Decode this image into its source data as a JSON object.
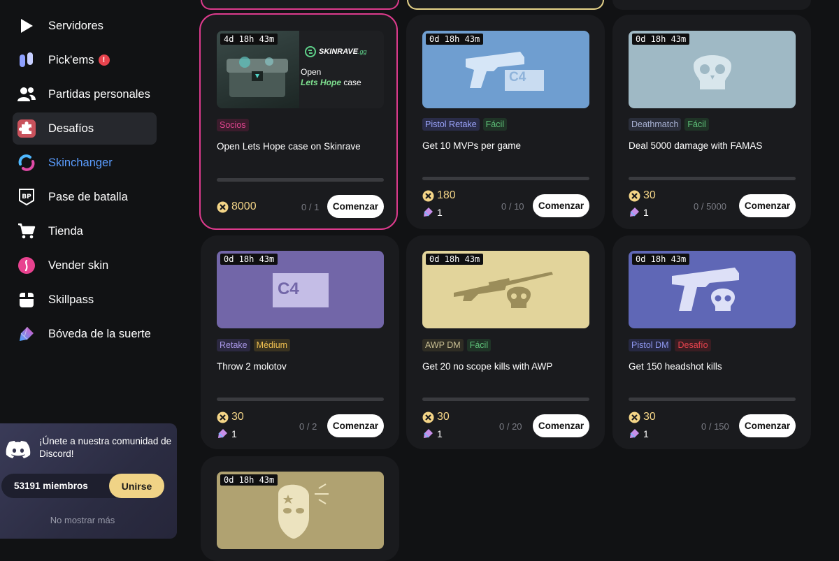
{
  "nav": {
    "items": [
      {
        "label": "Servidores",
        "icon": "play-icon"
      },
      {
        "label": "Pick'ems",
        "icon": "pickems-icon"
      },
      {
        "label": "Partidas personales",
        "icon": "users-icon"
      },
      {
        "label": "Desafíos",
        "icon": "puzzle-icon"
      },
      {
        "label": "Skinchanger",
        "icon": "skinchanger-icon"
      },
      {
        "label": "Pase de batalla",
        "icon": "battlepass-icon"
      },
      {
        "label": "Tienda",
        "icon": "cart-icon"
      },
      {
        "label": "Vender skin",
        "icon": "sell-skin-icon"
      },
      {
        "label": "Skillpass",
        "icon": "skillpass-icon"
      },
      {
        "label": "Bóveda de la suerte",
        "icon": "luck-vault-icon"
      }
    ],
    "alert_glyph": "!"
  },
  "discord": {
    "message": "¡Únete a nuestra comunidad de Discord!",
    "members": "53191 miembros",
    "join_label": "Unirse",
    "dismiss_label": "No mostrar más"
  },
  "colors": {
    "accent_pink": "#dd3b8d",
    "coin": "#f4d587",
    "button_yellow": "#f0d386"
  },
  "cards": [
    {
      "timer": "4d 18h 43m",
      "tags": [
        {
          "text": "Socios",
          "color": "#e0458f",
          "bg": "#3b1c2c"
        }
      ],
      "title": "Open Lets Hope case on Skinrave",
      "coins": "8000",
      "progress": "0 / 1",
      "button": "Comenzar",
      "sponsor": {
        "brand": "SKINRAVE",
        "brand_suffix": ".gg",
        "line1": "Open",
        "highlight": "Lets Hope",
        "line2_suffix": " case"
      }
    },
    {
      "timer": "0d 18h 43m",
      "tags": [
        {
          "text": "Pistol Retake",
          "color": "#9da6ff",
          "bg": "#2a2c48"
        },
        {
          "text": "Fácil",
          "color": "#5fc37a",
          "bg": "#1f3326"
        }
      ],
      "title": "Get 10 MVPs per game",
      "coins": "180",
      "gems": "1",
      "progress": "0 / 10",
      "button": "Comenzar",
      "c4": "C4"
    },
    {
      "timer": "0d 18h 43m",
      "tags": [
        {
          "text": "Deathmatch",
          "color": "#aab4d6",
          "bg": "#2a2e3a"
        },
        {
          "text": "Fácil",
          "color": "#5fc37a",
          "bg": "#1f3326"
        }
      ],
      "title": "Deal 5000 damage with FAMAS",
      "coins": "30",
      "gems": "1",
      "progress": "0 / 5000",
      "button": "Comenzar"
    },
    {
      "timer": "0d 18h 43m",
      "tags": [
        {
          "text": "Retake",
          "color": "#a896e6",
          "bg": "#2b2840"
        },
        {
          "text": "Médium",
          "color": "#f0c050",
          "bg": "#3a3320"
        }
      ],
      "title": "Throw 2 molotov",
      "coins": "30",
      "gems": "1",
      "progress": "0 / 2",
      "button": "Comenzar",
      "c4": "C4"
    },
    {
      "timer": "0d 18h 43m",
      "tags": [
        {
          "text": "AWP DM",
          "color": "#c9bf93",
          "bg": "#2f2d24"
        },
        {
          "text": "Fácil",
          "color": "#5fc37a",
          "bg": "#1f3326"
        }
      ],
      "title": "Get 20 no scope kills with AWP",
      "coins": "30",
      "gems": "1",
      "progress": "0 / 20",
      "button": "Comenzar"
    },
    {
      "timer": "0d 18h 43m",
      "tags": [
        {
          "text": "Pistol DM",
          "color": "#8f98f0",
          "bg": "#262842"
        },
        {
          "text": "Desafío",
          "color": "#e8434d",
          "bg": "#3a1d22"
        }
      ],
      "title": "Get 150 headshot kills",
      "coins": "30",
      "gems": "1",
      "progress": "0 / 150",
      "button": "Comenzar"
    },
    {
      "timer": "0d 18h 43m"
    }
  ]
}
